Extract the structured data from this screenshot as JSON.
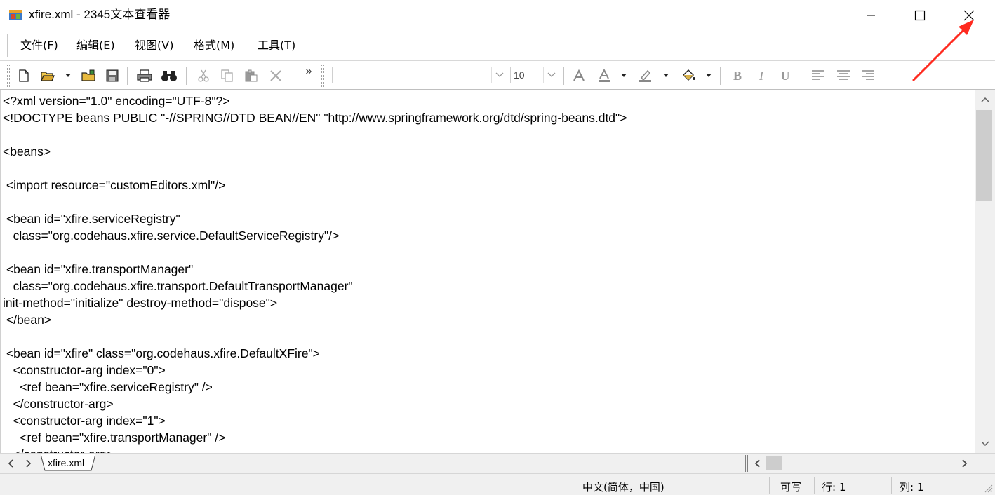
{
  "window": {
    "title": "xfire.xml - 2345文本查看器"
  },
  "menu": {
    "items": [
      {
        "label": "文件(F)"
      },
      {
        "label": "编辑(E)"
      },
      {
        "label": "视图(V)"
      },
      {
        "label": "格式(M)"
      },
      {
        "label": "工具(T)"
      }
    ]
  },
  "toolbar": {
    "font_name": "",
    "font_size": "10",
    "more_label": "»"
  },
  "editor": {
    "lines": [
      "<?xml version=\"1.0\" encoding=\"UTF-8\"?>",
      "<!DOCTYPE beans PUBLIC \"-//SPRING//DTD BEAN//EN\" \"http://www.springframework.org/dtd/spring-beans.dtd\">",
      "",
      "<beans>",
      "",
      " <import resource=\"customEditors.xml\"/>",
      "",
      " <bean id=\"xfire.serviceRegistry\"",
      "   class=\"org.codehaus.xfire.service.DefaultServiceRegistry\"/>",
      "",
      " <bean id=\"xfire.transportManager\"",
      "   class=\"org.codehaus.xfire.transport.DefaultTransportManager\"",
      "init-method=\"initialize\" destroy-method=\"dispose\">",
      " </bean>",
      "",
      " <bean id=\"xfire\" class=\"org.codehaus.xfire.DefaultXFire\">",
      "   <constructor-arg index=\"0\">",
      "     <ref bean=\"xfire.serviceRegistry\" />",
      "   </constructor-arg>",
      "   <constructor-arg index=\"1\">",
      "     <ref bean=\"xfire.transportManager\" />",
      "   </constructor-arg>"
    ]
  },
  "tabs": {
    "file_tab": "xfire.xml"
  },
  "status": {
    "encoding": "中文(简体，中国)",
    "mode": "可写",
    "row": "行: 1",
    "col": "列: 1"
  },
  "colors": {
    "annotation_arrow": "#ff2a1f",
    "chrome_bg": "#f0f0f0"
  }
}
